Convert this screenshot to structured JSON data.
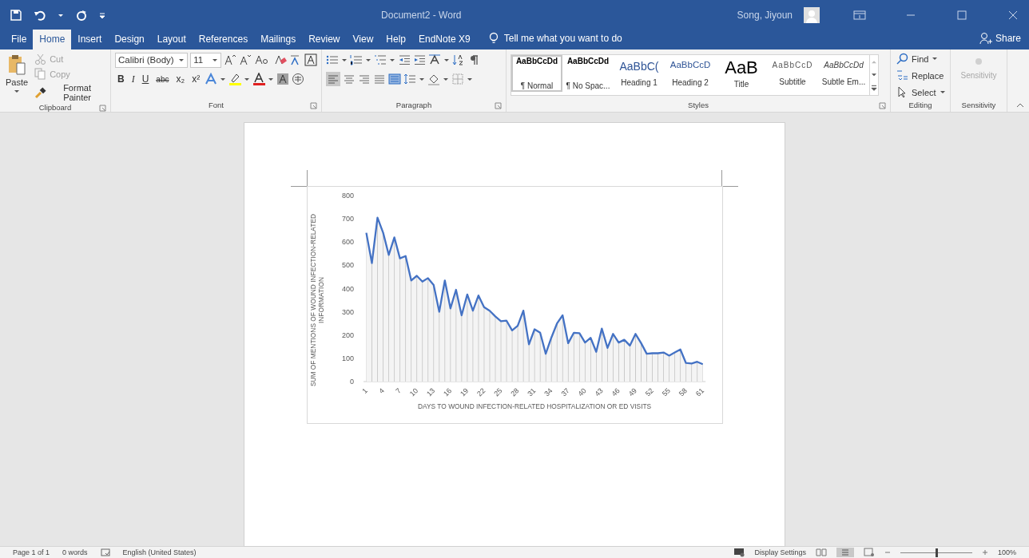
{
  "title_bar": {
    "document_title": "Document2  -  Word",
    "user_name": "Song, Jiyoun"
  },
  "tabs": [
    {
      "label": "File",
      "selected": false
    },
    {
      "label": "Home",
      "selected": true
    },
    {
      "label": "Insert",
      "selected": false
    },
    {
      "label": "Design",
      "selected": false
    },
    {
      "label": "Layout",
      "selected": false
    },
    {
      "label": "References",
      "selected": false
    },
    {
      "label": "Mailings",
      "selected": false
    },
    {
      "label": "Review",
      "selected": false
    },
    {
      "label": "View",
      "selected": false
    },
    {
      "label": "Help",
      "selected": false
    },
    {
      "label": "EndNote X9",
      "selected": false
    }
  ],
  "tell_me": {
    "placeholder": "Tell me what you want to do"
  },
  "share": "Share",
  "ribbon": {
    "clipboard": {
      "label": "Clipboard",
      "paste": "Paste",
      "items": [
        {
          "label": "Cut",
          "disabled": true
        },
        {
          "label": "Copy",
          "disabled": true
        },
        {
          "label": "Format Painter",
          "disabled": false
        }
      ]
    },
    "font": {
      "label": "Font",
      "name": "Calibri (Body)",
      "size": "11",
      "format_buttons": [
        {
          "label": "B",
          "kind": "bold"
        },
        {
          "label": "I",
          "kind": "italic"
        },
        {
          "label": "U",
          "kind": "underline"
        },
        {
          "label": "abc",
          "kind": "strike"
        },
        {
          "label": "x₂",
          "kind": "plain"
        },
        {
          "label": "x²",
          "kind": "plain"
        }
      ]
    },
    "paragraph": {
      "label": "Paragraph"
    },
    "styles": {
      "label": "Styles",
      "items": [
        {
          "preview": "AaBbCcDd",
          "name": "¶ Normal",
          "kind": "body",
          "selected": true
        },
        {
          "preview": "AaBbCcDd",
          "name": "¶ No Spac...",
          "kind": "body",
          "selected": false
        },
        {
          "preview": "AaBbC(",
          "name": "Heading 1",
          "kind": "heading1",
          "selected": false
        },
        {
          "preview": "AaBbCcD",
          "name": "Heading 2",
          "kind": "heading2",
          "selected": false
        },
        {
          "preview": "AaB",
          "name": "Title",
          "kind": "title",
          "selected": false
        },
        {
          "preview": "AaBbCcD",
          "name": "Subtitle",
          "kind": "subtitle",
          "selected": false
        },
        {
          "preview": "AaBbCcDd",
          "name": "Subtle Em...",
          "kind": "emphasis",
          "selected": false
        }
      ]
    },
    "editing": {
      "label": "Editing",
      "find": "Find",
      "replace": "Replace",
      "select": "Select"
    },
    "sensitivity": {
      "label": "Sensitivity",
      "button": "Sensitivity",
      "disabled": true
    }
  },
  "document": {
    "chart": {
      "chart_data": {
        "type": "area",
        "xlabel": "DAYS TO WOUND INFECTION-RELATED HOSPITALIZATION OR ED VISITS",
        "ylabel": "SUM OF MENTIONS OF WOUND INFECTION-RELATED INFORMATION",
        "x": [
          1,
          2,
          3,
          4,
          5,
          6,
          7,
          8,
          9,
          10,
          11,
          12,
          13,
          14,
          15,
          16,
          17,
          18,
          19,
          20,
          21,
          22,
          23,
          24,
          25,
          26,
          27,
          28,
          29,
          30,
          31,
          32,
          33,
          34,
          35,
          36,
          37,
          38,
          39,
          40,
          41,
          42,
          43,
          44,
          45,
          46,
          47,
          48,
          49,
          50,
          51,
          52,
          53,
          54,
          55,
          56,
          57,
          58,
          59,
          60,
          61
        ],
        "series": [
          {
            "color": "#4472c4",
            "values": [
              640,
              510,
              705,
              640,
              545,
              620,
              530,
              540,
              435,
              455,
              430,
              445,
              415,
              300,
              435,
              315,
              395,
              285,
              375,
              305,
              370,
              320,
              305,
              280,
              260,
              262,
              220,
              240,
              305,
              160,
              225,
              210,
              120,
              190,
              250,
              285,
              165,
              210,
              208,
              168,
              188,
              128,
              228,
              145,
              205,
              168,
              180,
              155,
              205,
              165,
              120,
              122,
              122,
              125,
              112,
              125,
              138,
              80,
              78,
              85,
              75
            ]
          }
        ],
        "xlim": [
          0.5,
          61.5
        ],
        "ylim": [
          0,
          800
        ],
        "yticks": [
          0,
          100,
          200,
          300,
          400,
          500,
          600,
          700,
          800
        ],
        "xticks": [
          1,
          4,
          7,
          10,
          13,
          16,
          19,
          22,
          25,
          28,
          31,
          34,
          37,
          40,
          43,
          46,
          49,
          52,
          55,
          58,
          61
        ]
      }
    }
  },
  "status_bar": {
    "page": "Page 1 of 1",
    "words": "0 words",
    "language": "English (United States)",
    "display_settings": "Display Settings",
    "zoom": "100%",
    "zoom_level": {
      "level": 0.5
    }
  }
}
